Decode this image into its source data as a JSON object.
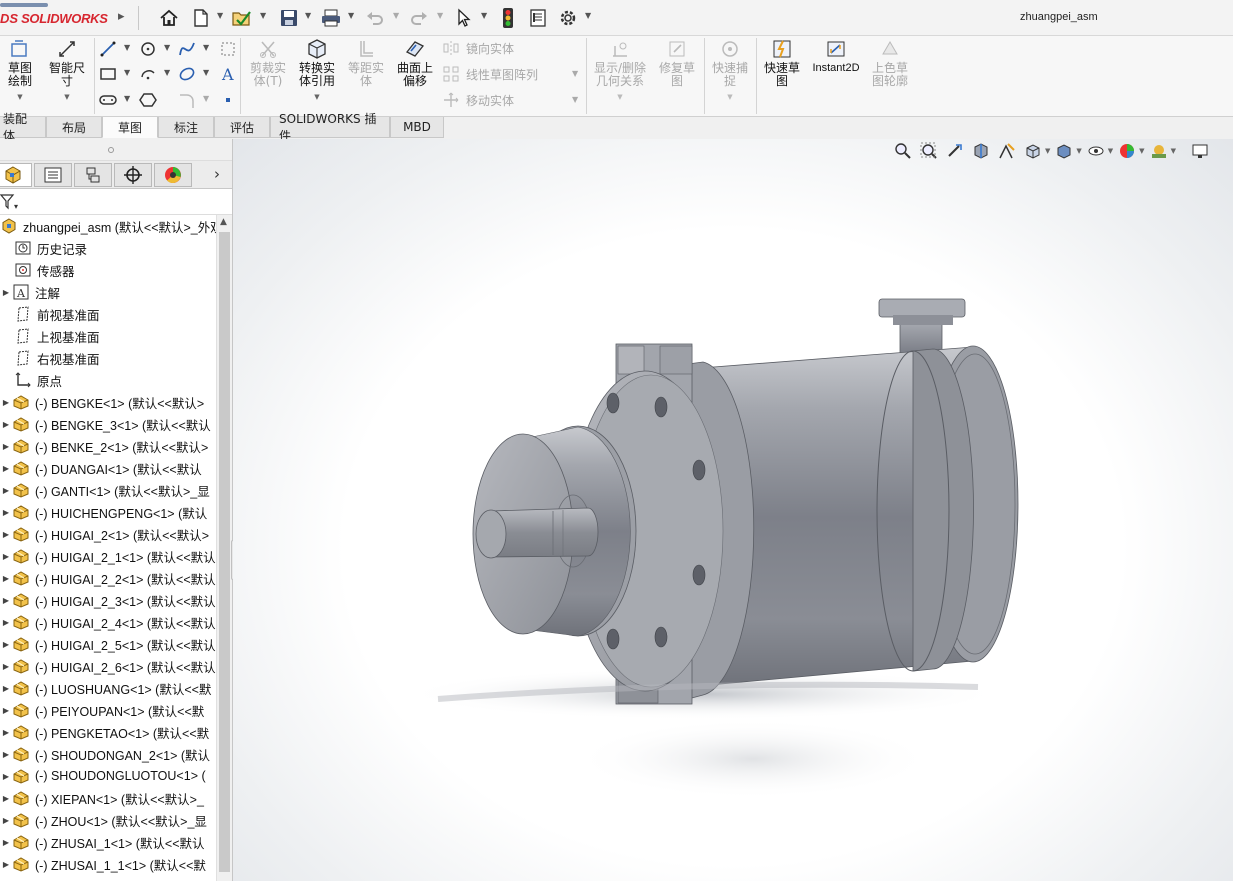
{
  "app": {
    "logo_prefix": "DS",
    "logo_text": "SOLIDWORKS",
    "document_title": "zhuangpei_asm"
  },
  "quick_access": {
    "icons": [
      "home-icon",
      "new-document-icon",
      "open-icon",
      "save-icon",
      "print-icon",
      "undo-icon",
      "redo-icon",
      "select-icon",
      "rebuild-icon",
      "file-properties-icon",
      "options-icon"
    ]
  },
  "ribbon": {
    "sketch": "草图绘制",
    "smart_dimension": "智能尺寸",
    "trim_entities": "剪裁实体(T)",
    "convert_entities": "转换实体引用",
    "offset_entities": "等距实体",
    "offset_on_surface": "曲面上偏移",
    "mirror_entities": "镜向实体",
    "linear_pattern": "线性草图阵列",
    "move_entities": "移动实体",
    "display_relations": "显示/删除几何关系",
    "repair_sketch": "修复草图",
    "quick_snaps": "快速捕捉",
    "rapid_sketch": "快速草图",
    "instant2d": "Instant2D",
    "shaded_sketch": "上色草图轮廓"
  },
  "tabs": [
    {
      "label": "装配体",
      "active": false
    },
    {
      "label": "布局",
      "active": false
    },
    {
      "label": "草图",
      "active": true
    },
    {
      "label": "标注",
      "active": false
    },
    {
      "label": "评估",
      "active": false
    },
    {
      "label": "SOLIDWORKS 插件",
      "active": false
    },
    {
      "label": "MBD",
      "active": false
    }
  ],
  "feature_tree": {
    "root": "zhuangpei_asm  (默认<<默认>_外观",
    "items": [
      {
        "label": "历史记录",
        "icon": "history-icon",
        "expandable": false
      },
      {
        "label": "传感器",
        "icon": "sensor-icon",
        "expandable": false
      },
      {
        "label": "注解",
        "icon": "annotation-icon",
        "expandable": true
      },
      {
        "label": "前视基准面",
        "icon": "plane-icon",
        "expandable": false
      },
      {
        "label": "上视基准面",
        "icon": "plane-icon",
        "expandable": false
      },
      {
        "label": "右视基准面",
        "icon": "plane-icon",
        "expandable": false
      },
      {
        "label": "原点",
        "icon": "origin-icon",
        "expandable": false
      },
      {
        "label": "(-) BENGKE<1> (默认<<默认>",
        "icon": "part-icon",
        "expandable": true
      },
      {
        "label": "(-) BENGKE_3<1> (默认<<默认",
        "icon": "part-icon",
        "expandable": true
      },
      {
        "label": "(-) BENKE_2<1> (默认<<默认>",
        "icon": "part-icon",
        "expandable": true
      },
      {
        "label": "(-) DUANGAI<1> (默认<<默认",
        "icon": "part-icon",
        "expandable": true
      },
      {
        "label": "(-) GANTI<1> (默认<<默认>_显",
        "icon": "part-icon",
        "expandable": true
      },
      {
        "label": "(-) HUICHENGPENG<1> (默认",
        "icon": "part-icon",
        "expandable": true
      },
      {
        "label": "(-) HUIGAI_2<1> (默认<<默认>",
        "icon": "part-icon",
        "expandable": true
      },
      {
        "label": "(-) HUIGAI_2_1<1> (默认<<默认",
        "icon": "part-icon",
        "expandable": true
      },
      {
        "label": "(-) HUIGAI_2_2<1> (默认<<默认",
        "icon": "part-icon",
        "expandable": true
      },
      {
        "label": "(-) HUIGAI_2_3<1> (默认<<默认",
        "icon": "part-icon",
        "expandable": true
      },
      {
        "label": "(-) HUIGAI_2_4<1> (默认<<默认",
        "icon": "part-icon",
        "expandable": true
      },
      {
        "label": "(-) HUIGAI_2_5<1> (默认<<默认",
        "icon": "part-icon",
        "expandable": true
      },
      {
        "label": "(-) HUIGAI_2_6<1> (默认<<默认",
        "icon": "part-icon",
        "expandable": true
      },
      {
        "label": "(-) LUOSHUANG<1> (默认<<默",
        "icon": "part-icon",
        "expandable": true
      },
      {
        "label": "(-) PEIYOUPAN<1> (默认<<默",
        "icon": "part-icon",
        "expandable": true
      },
      {
        "label": "(-) PENGKETAO<1> (默认<<默",
        "icon": "part-icon",
        "expandable": true
      },
      {
        "label": "(-) SHOUDONGAN_2<1> (默认",
        "icon": "part-icon",
        "expandable": true
      },
      {
        "label": "(-) SHOUDONGLUOTOU<1> (",
        "icon": "part-icon",
        "expandable": true
      },
      {
        "label": "(-) XIEPAN<1> (默认<<默认>_",
        "icon": "part-icon",
        "expandable": true
      },
      {
        "label": "(-) ZHOU<1> (默认<<默认>_显",
        "icon": "part-icon",
        "expandable": true
      },
      {
        "label": "(-) ZHUSAI_1<1> (默认<<默认",
        "icon": "part-icon",
        "expandable": true
      },
      {
        "label": "(-) ZHUSAI_1_1<1> (默认<<默",
        "icon": "part-icon",
        "expandable": true
      }
    ]
  },
  "panel_tabs": [
    "feature-manager-icon",
    "property-manager-icon",
    "configuration-manager-icon",
    "dimxpert-icon",
    "display-manager-icon"
  ],
  "heads_up_toolbar": [
    "zoom-to-fit-icon",
    "zoom-area-icon",
    "previous-view-icon",
    "section-view-icon",
    "dynamic-annotation-icon",
    "view-orientation-icon",
    "display-style-icon",
    "hide-show-icon",
    "edit-appearance-icon",
    "apply-scene-icon",
    "view-settings-icon"
  ],
  "colors": {
    "accent_red": "#d7262f",
    "model_gray": "#8e9198",
    "part_icon_yellow": "#e8b53a"
  }
}
